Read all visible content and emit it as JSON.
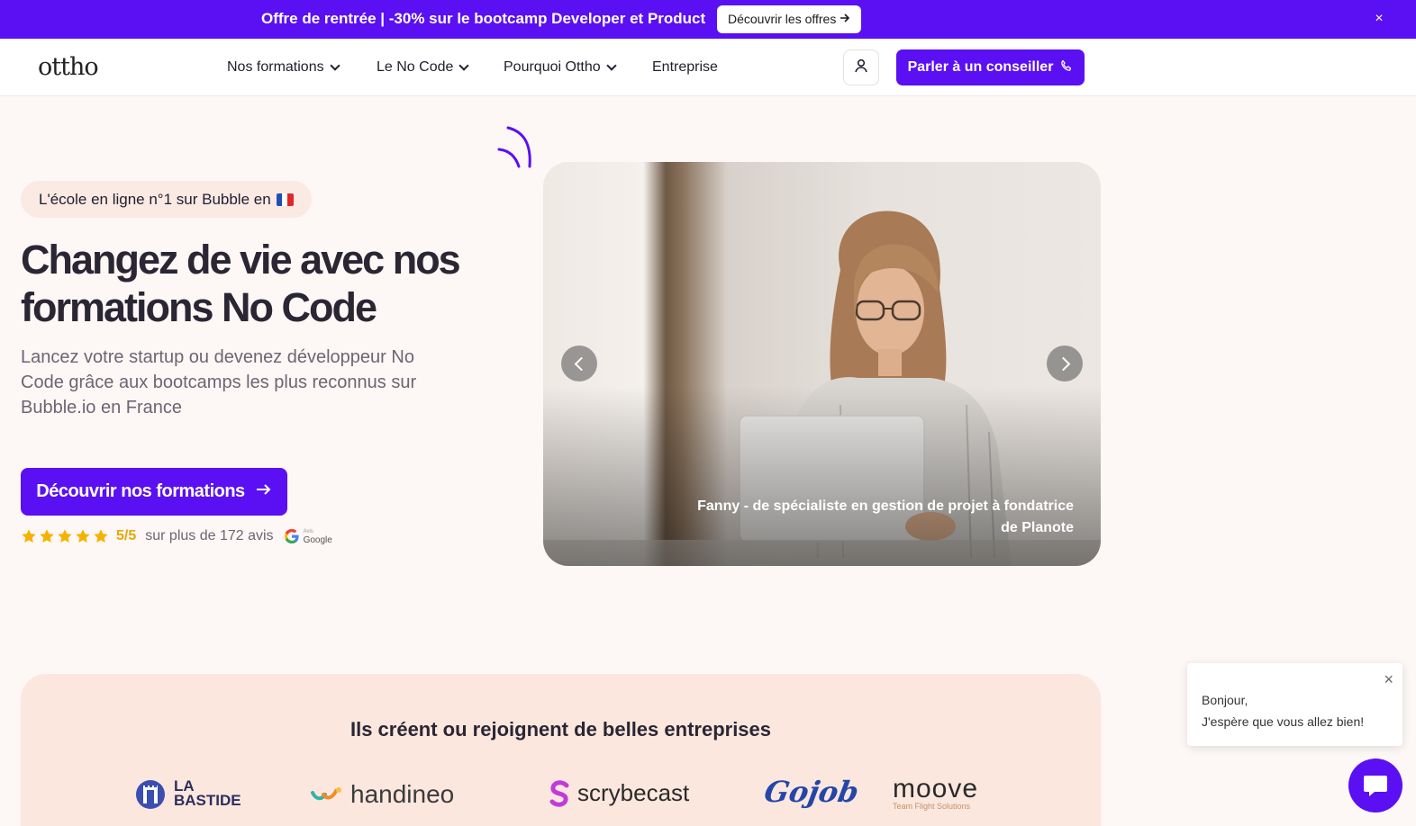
{
  "promo": {
    "text": "Offre de rentrée | -30% sur le bootcamp Developer et Product",
    "button_label": "Découvrir les offres",
    "close_label": "×"
  },
  "nav": {
    "logo": "ottho",
    "items": [
      {
        "label": "Nos formations",
        "has_dropdown": true
      },
      {
        "label": "Le No Code",
        "has_dropdown": true
      },
      {
        "label": "Pourquoi Ottho",
        "has_dropdown": true
      },
      {
        "label": "Entreprise",
        "has_dropdown": false
      }
    ],
    "account_icon": "user-icon",
    "cta_label": "Parler à un conseiller",
    "cta_icon": "phone-icon"
  },
  "hero": {
    "badge": "L'école en ligne n°1 sur Bubble en",
    "title": "Changez de vie avec nos formations No Code",
    "subtitle": "Lancez votre startup ou devenez développeur No Code grâce aux bootcamps les plus reconnus sur Bubble.io en France",
    "cta_label": "Découvrir nos formations",
    "rating": {
      "stars": 5,
      "score": "5/5",
      "reviews_text": "sur plus de 172 avis",
      "source_small": "Avis",
      "source": "Google"
    }
  },
  "carousel": {
    "caption": "Fanny - de spécialiste en gestion de projet à fondatrice de Planote",
    "prev_icon": "chevron-left-icon",
    "next_icon": "chevron-right-icon"
  },
  "logos": {
    "title": "Ils créent ou rejoignent de belles entreprises",
    "brands": [
      {
        "line1": "LA",
        "line2": "BASTIDE"
      },
      {
        "name": "handineo"
      },
      {
        "name": "scrybecast"
      },
      {
        "name": "Gojob"
      },
      {
        "name": "moove",
        "tagline": "Team Flight Solutions"
      }
    ]
  },
  "chat": {
    "line1": "Bonjour,",
    "line2": "J'espère que vous allez bien!",
    "close_label": "×"
  },
  "colors": {
    "brand": "#5a10f2",
    "background": "#fdf7f5",
    "panel": "#fce7de",
    "star": "#f5b301"
  }
}
